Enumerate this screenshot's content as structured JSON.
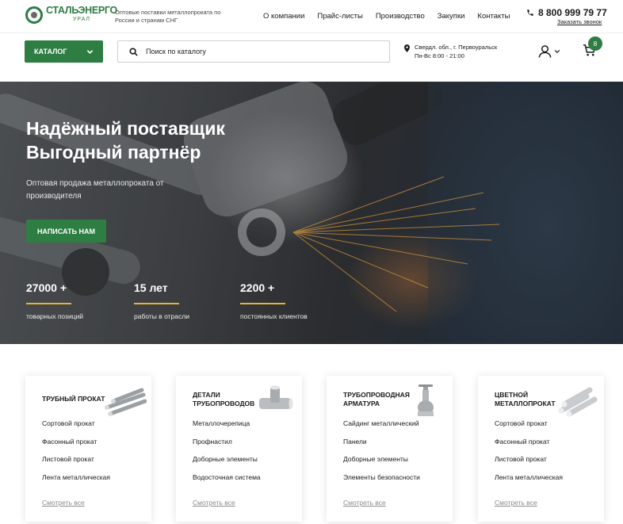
{
  "header": {
    "logo_name": "СТАЛЬЭНЕРГО",
    "logo_sub": "УРАЛ",
    "tagline": "Оптовые поставки металлопроката по России и странам СНГ",
    "nav": [
      "О компании",
      "Прайс-листы",
      "Производство",
      "Закупки",
      "Контакты"
    ],
    "phone": "8 800 999 79 77",
    "callback": "Заказать звонок"
  },
  "toolbar": {
    "catalog_label": "КАТАЛОГ",
    "search_placeholder": "Поиск по каталогу",
    "address_line1": "Свердл. обл., г. Первоуральск",
    "address_line2": "Пн-Вс 8:00 - 21:00",
    "cart_count": "8"
  },
  "hero": {
    "title_line1": "Надёжный поставщик",
    "title_line2": "Выгодный партнёр",
    "subtitle": "Оптовая продажа металлопроката от производителя",
    "button": "НАПИСАТЬ НАМ",
    "stats": [
      {
        "value": "27000 +",
        "label": "товарных позиций"
      },
      {
        "value": "15 лет",
        "label": "работы в отрасли"
      },
      {
        "value": "2200 +",
        "label": "постоянных клиентов"
      }
    ]
  },
  "categories": [
    {
      "title": "ТРУБНЫЙ ПРОКАТ",
      "icon": "pipes-icon",
      "items": [
        "Сортовой прокат",
        "Фасонный прокат",
        "Листовой прокат",
        "Лента металлическая"
      ],
      "more": "Смотреть все"
    },
    {
      "title": "ДЕТАЛИ ТРУБОПРОВОДОВ",
      "icon": "pipe-tee-icon",
      "items": [
        "Металлочерепица",
        "Профнастил",
        "Доборные элементы",
        "Водосточная система"
      ],
      "more": "Смотреть все"
    },
    {
      "title": "ТРУБОПРОВОДНАЯ АРМАТУРА",
      "icon": "valve-icon",
      "items": [
        "Сайдинг металлический",
        "Панели",
        "Доборные элементы",
        "Элементы безопасности"
      ],
      "more": "Смотреть все"
    },
    {
      "title": "ЦВЕТНОЙ МЕТАЛЛОПРОКАТ",
      "icon": "metal-rods-icon",
      "items": [
        "Сортовой прокат",
        "Фасонный прокат",
        "Листовой прокат",
        "Лента металлическая"
      ],
      "more": "Смотреть все"
    }
  ],
  "colors": {
    "brand": "#2e7d43",
    "accent": "#e7b23c"
  }
}
